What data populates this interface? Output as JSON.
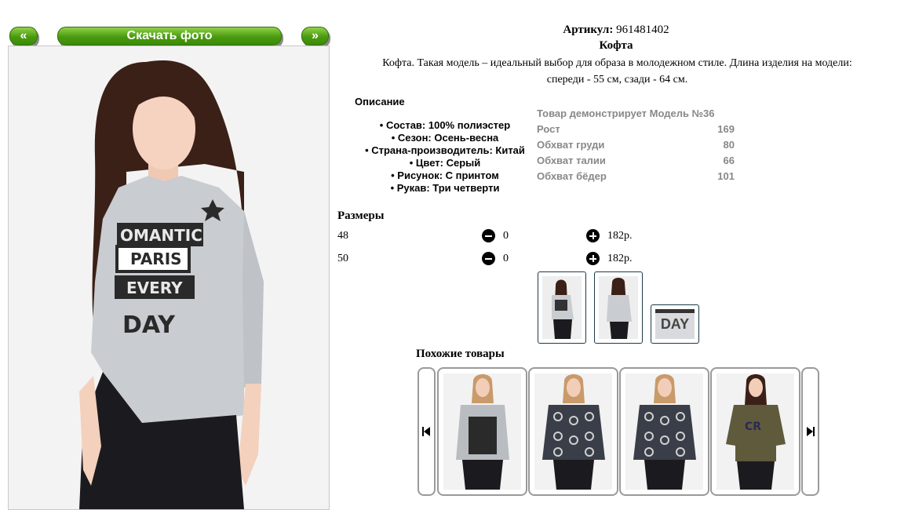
{
  "nav": {
    "prev_label": "«",
    "download_label": "Скачать фото",
    "next_label": "»"
  },
  "product": {
    "article_label": "Артикул:",
    "article_value": "961481402",
    "name": "Кофта",
    "description_line1": "Кофта. Такая модель – идеальный выбор для образа в молодежном стиле. Длина изделия на модели:",
    "description_line2": "спереди - 55 см, сзади - 64 см.",
    "main_image_icon": "product-photo-model-grey-blouse"
  },
  "description": {
    "heading": "Описание",
    "items": [
      "• Состав: 100% полиэстер",
      "• Сезон: Осень-весна",
      "• Страна-производитель: Китай",
      "• Цвет: Серый",
      "• Рисунок: С принтом",
      "• Рукав: Три четверти"
    ]
  },
  "model": {
    "heading": "Товар демонстрирует Модель №36",
    "rows": [
      {
        "label": "Рост",
        "value": "169"
      },
      {
        "label": "Обхват груди",
        "value": "80"
      },
      {
        "label": "Обхват талии",
        "value": "66"
      },
      {
        "label": "Обхват бёдер",
        "value": "101"
      }
    ]
  },
  "sizes": {
    "heading": "Размеры",
    "rows": [
      {
        "size": "48",
        "qty": "0",
        "price": "182р."
      },
      {
        "size": "50",
        "qty": "0",
        "price": "182р."
      }
    ]
  },
  "thumbnails": {
    "third_label": "DAY"
  },
  "similar": {
    "heading": "Похожие товары",
    "prev_icon": "skip-back-icon",
    "next_icon": "skip-forward-icon",
    "card4_print": "CR",
    "colors": {
      "card1": "#b9bcc0",
      "card2": "#3a3e48",
      "card3": "#3a3e48",
      "card4": "#5f5a3c"
    }
  },
  "colors": {
    "button_green": "#4a9a10",
    "muted_text": "#888888"
  }
}
